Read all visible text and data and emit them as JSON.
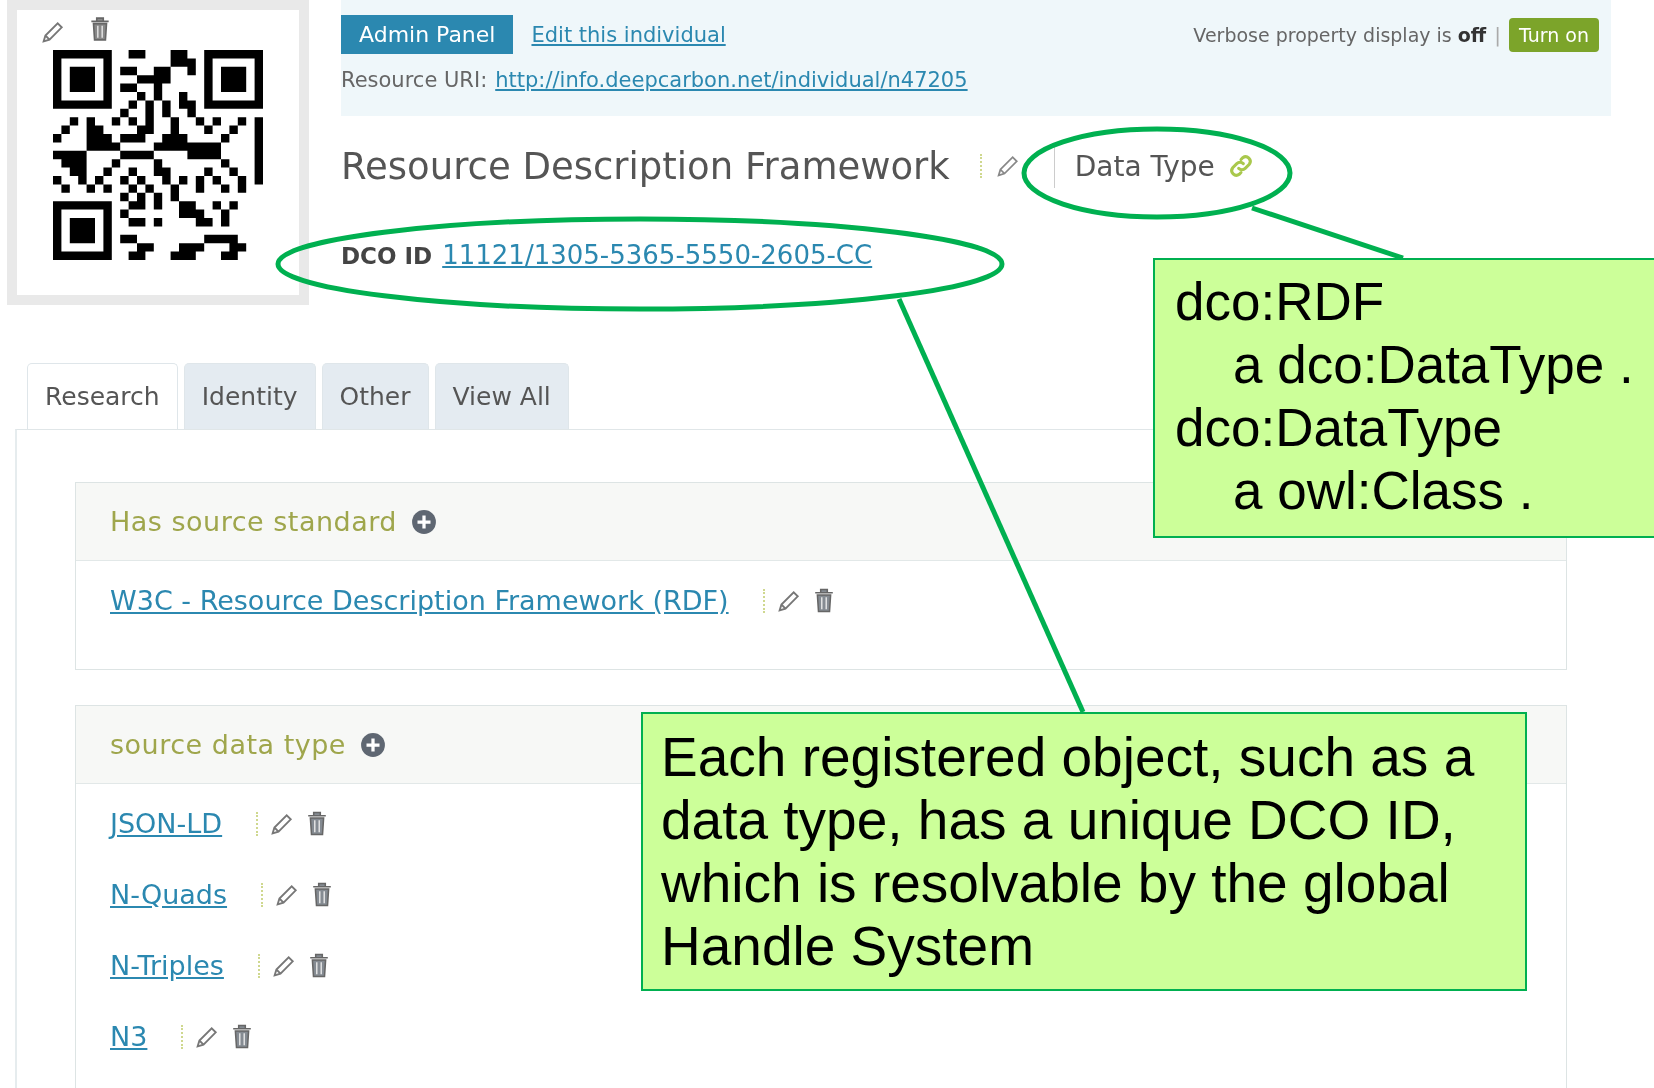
{
  "admin_bar": {
    "button": "Admin Panel",
    "edit_link": "Edit this individual",
    "verbose_text": "Verbose property display is **off**",
    "separator": "|",
    "turn_on_button": "Turn on",
    "uri_label": "Resource URI:",
    "uri": "http://info.deepcarbon.net/individual/n47205"
  },
  "title": "Resource Description Framework",
  "type_label": "Data Type",
  "dco_id": {
    "label": "DCO ID",
    "value": "11121/1305-5365-5550-2605-CC"
  },
  "tabs": [
    {
      "label": "Research",
      "selected": true
    },
    {
      "label": "Identity",
      "selected": false
    },
    {
      "label": "Other",
      "selected": false
    },
    {
      "label": "View All",
      "selected": false
    }
  ],
  "sections": [
    {
      "title": "Has source standard",
      "items": [
        {
          "label": "W3C - Resource Description Framework (RDF)"
        }
      ]
    },
    {
      "title": "source data type",
      "items": [
        {
          "label": "JSON-LD"
        },
        {
          "label": "N-Quads"
        },
        {
          "label": "N-Triples"
        },
        {
          "label": "N3"
        }
      ]
    }
  ],
  "annotations": [
    {
      "kind": "listing",
      "statements": [
        {
          "text": "dco:RDF",
          "children": [
            {
              "text": "a dco:DataType ."
            }
          ]
        },
        {
          "text": "dco:DataType",
          "children": [
            {
              "text": "a owl:Class ."
            }
          ]
        }
      ]
    },
    {
      "kind": "note",
      "text": "Each registered object, such as a data type, has a unique DCO ID, which is resolvable by the global Handle System"
    }
  ]
}
